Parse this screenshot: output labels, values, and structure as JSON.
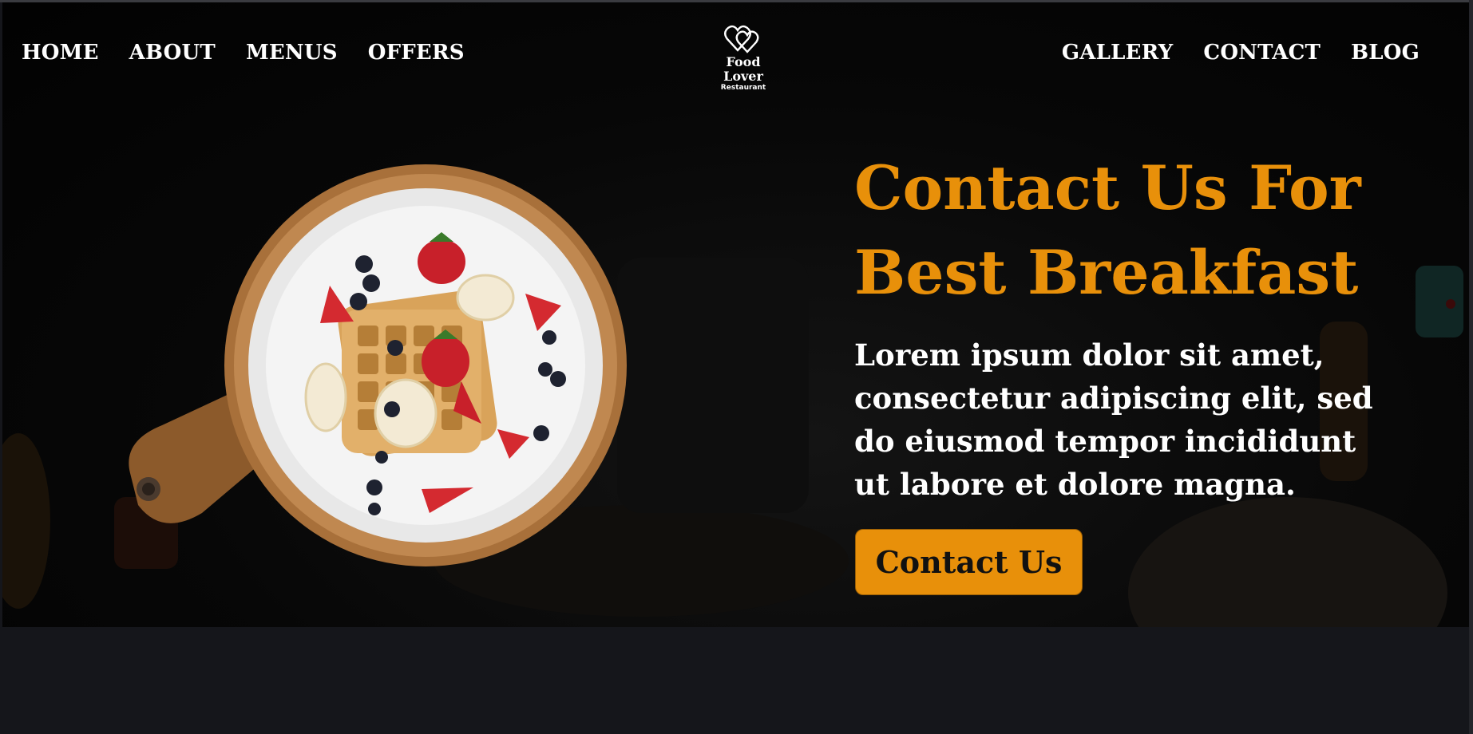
{
  "nav": {
    "left": [
      {
        "label": "HOME"
      },
      {
        "label": "ABOUT"
      },
      {
        "label": "MENUS"
      },
      {
        "label": "OFFERS"
      }
    ],
    "right": [
      {
        "label": "GALLERY"
      },
      {
        "label": "CONTACT"
      },
      {
        "label": "BLOG"
      }
    ]
  },
  "logo": {
    "icon": "double-heart-icon",
    "name": "Food Lover",
    "subtitle": "Restaurant"
  },
  "hero": {
    "headline": "Contact Us For Best Breakfast",
    "body": "Lorem ipsum dolor sit amet, consectetur adipiscing elit, sed do eiusmod tempor incididunt ut labore et dolore magna.",
    "cta_label": "Contact Us",
    "image": "waffles-with-strawberries-and-blueberries-on-wooden-board"
  },
  "colors": {
    "accent": "#e8900a",
    "hero_background": "#050505",
    "page_background": "#15161b",
    "text": "#ffffff"
  }
}
